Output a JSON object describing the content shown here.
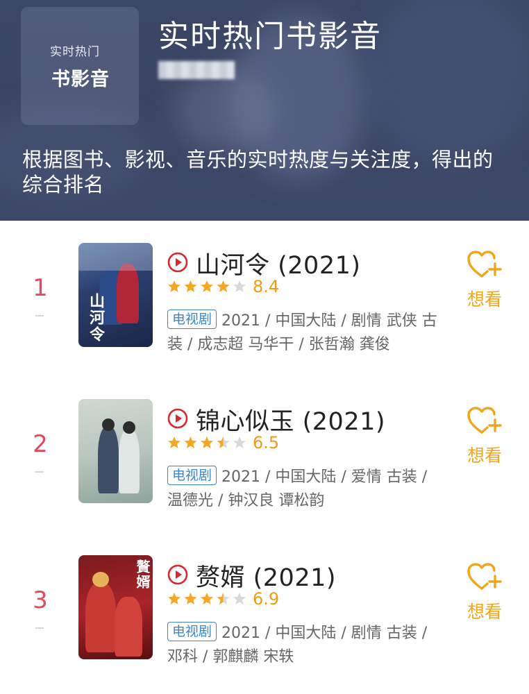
{
  "header": {
    "logo_small": "实时热门",
    "logo_big": "书影音",
    "title": "实时热门书影音",
    "description": "根据图书、影视、音乐的实时热度与关注度，得出的综合排名"
  },
  "colors": {
    "rank": "#e04a5e",
    "star": "#f5a623",
    "score": "#f19b15",
    "tag": "#3a86c8",
    "want": "#f1a51c",
    "play": "#d9272e"
  },
  "items": [
    {
      "rank": "1",
      "title": "山河令 (2021)",
      "rating": 4.0,
      "score": "8.4",
      "tag": "电视剧",
      "meta": "2021 / 中国大陆 / 剧情 武侠 古装 / 成志超 马华干 / 张哲瀚 龚俊",
      "want_label": "想看",
      "poster_text": "山河令"
    },
    {
      "rank": "2",
      "title": "锦心似玉 (2021)",
      "rating": 3.5,
      "score": "6.5",
      "tag": "电视剧",
      "meta": "2021 / 中国大陆 / 爱情 古装 / 温德光 / 钟汉良 谭松韵",
      "want_label": "想看",
      "poster_text": ""
    },
    {
      "rank": "3",
      "title": "赘婿 (2021)",
      "rating": 3.5,
      "score": "6.9",
      "tag": "电视剧",
      "meta": "2021 / 中国大陆 / 剧情 古装 / 邓科 / 郭麒麟 宋轶",
      "want_label": "想看",
      "poster_text": "贅婿"
    }
  ]
}
